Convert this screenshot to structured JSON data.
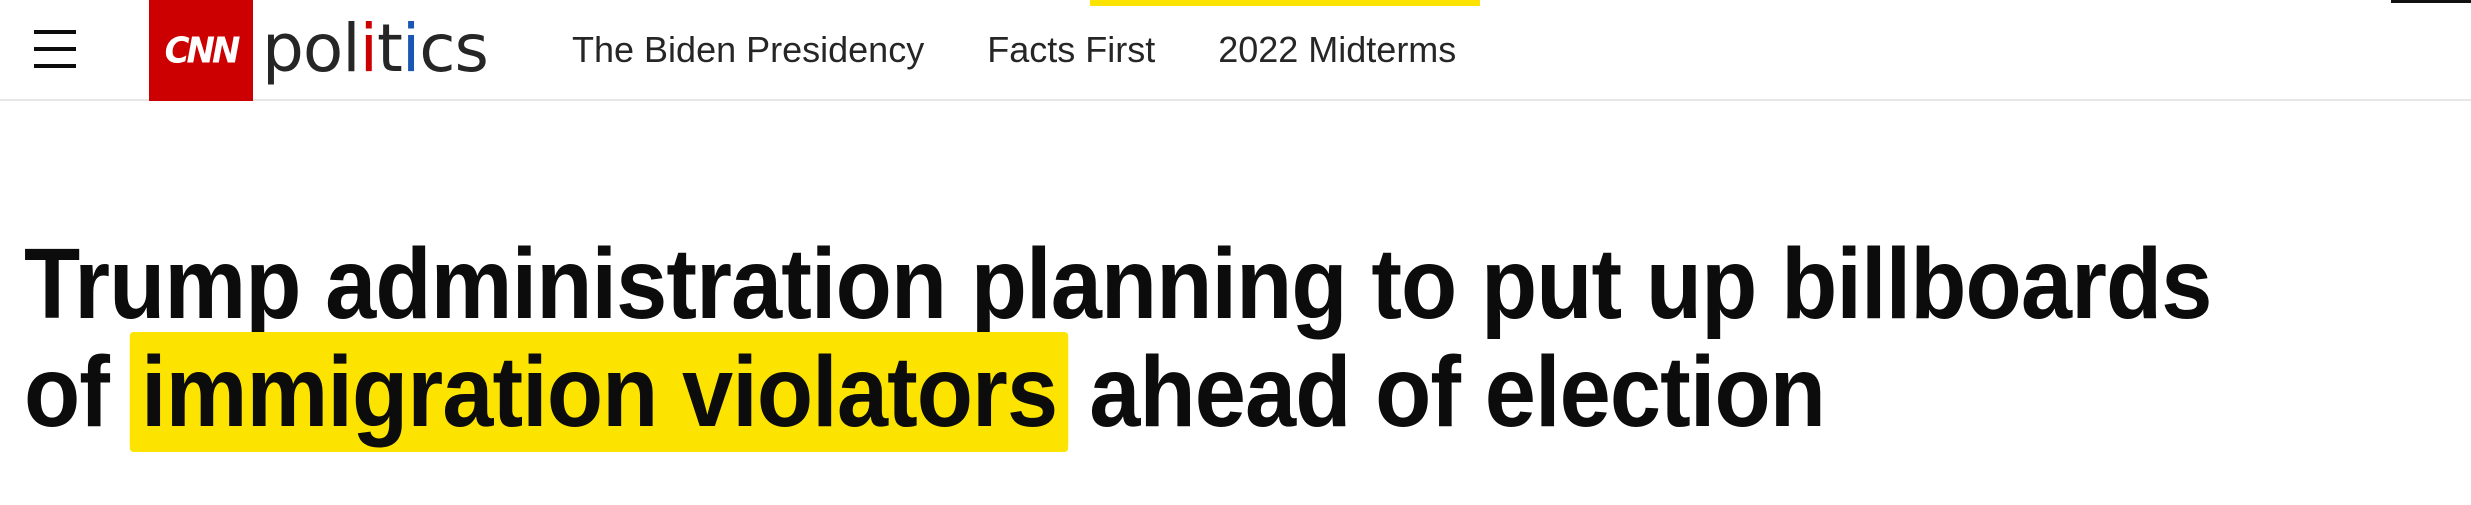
{
  "header": {
    "menu_icon": "hamburger-menu-icon",
    "brand": {
      "logo_text": "CNN",
      "section_name": "politics",
      "accent_red": "#cc0000",
      "accent_blue": "#1a56b3"
    },
    "nav": [
      {
        "label": "The Biden Presidency"
      },
      {
        "label": "Facts First"
      },
      {
        "label": "2022 Midterms"
      }
    ]
  },
  "article": {
    "headline": {
      "line1": "Trump administration planning to put up billboards",
      "line2_prefix": "of",
      "line2_highlight": "immigration violators",
      "line2_suffix": "ahead of election",
      "highlight_color": "#fce300"
    }
  }
}
